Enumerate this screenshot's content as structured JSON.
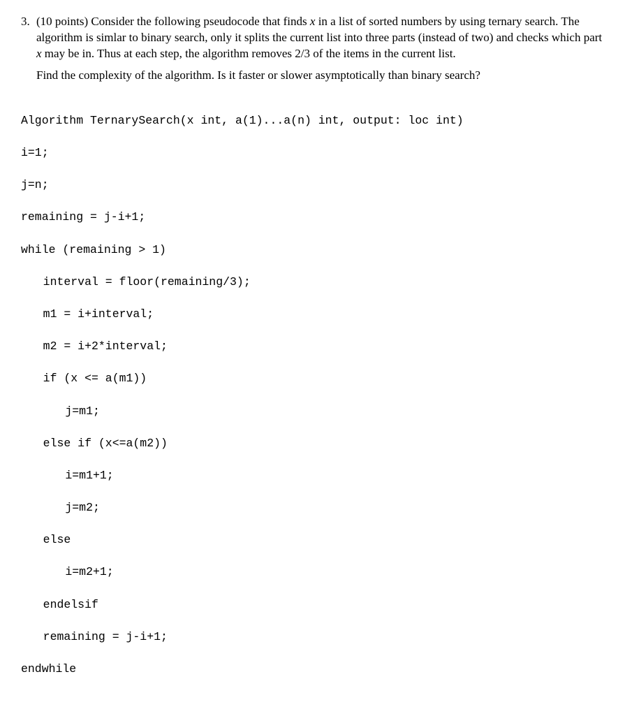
{
  "problem": {
    "number": "3.",
    "points": "(10 points)",
    "intro": "Consider the following pseudocode that finds",
    "var_x": "x",
    "intro2": "in a list of sorted numbers by using ternary search. The algorithm is simlar to binary search, only it splits the current list into three parts (instead of two) and checks which part",
    "var_x2": "x",
    "intro3": "may be in. Thus at each step, the algorithm removes 2/3 of the items in the current list.",
    "question": "Find the complexity of the algorithm. Is it faster or slower asymptotically than binary search?"
  },
  "code": {
    "l01": "Algorithm TernarySearch(x int, a(1)...a(n) int, output: loc int)",
    "l02": "i=1;",
    "l03": "j=n;",
    "l04": "remaining = j-i+1;",
    "l05": "while (remaining > 1)",
    "l06": "interval = floor(remaining/3);",
    "l07": "m1 = i+interval;",
    "l08": "m2 = i+2*interval;",
    "l09": "if (x <= a(m1))",
    "l10": "j=m1;",
    "l11": "else if (x<=a(m2))",
    "l12": "i=m1+1;",
    "l13": "j=m2;",
    "l14": "else",
    "l15": "i=m2+1;",
    "l16": "endelsif",
    "l17": "remaining = j-i+1;",
    "l18": "endwhile"
  }
}
